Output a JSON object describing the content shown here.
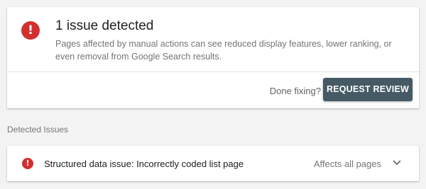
{
  "summary": {
    "icon": "error-icon",
    "title": "1 issue detected",
    "description": "Pages affected by manual actions can see reduced display features, lower ranking, or even removal from Google Search results.",
    "done_prompt": "Done fixing?",
    "request_button": "REQUEST REVIEW",
    "error_color": "#d32f2f",
    "button_color": "#455a64"
  },
  "detected": {
    "section_label": "Detected Issues",
    "issues": [
      {
        "icon": "error-icon",
        "title": "Structured data issue: Incorrectly coded list page",
        "scope": "Affects all pages",
        "expand_icon": "chevron-down-icon"
      }
    ]
  }
}
